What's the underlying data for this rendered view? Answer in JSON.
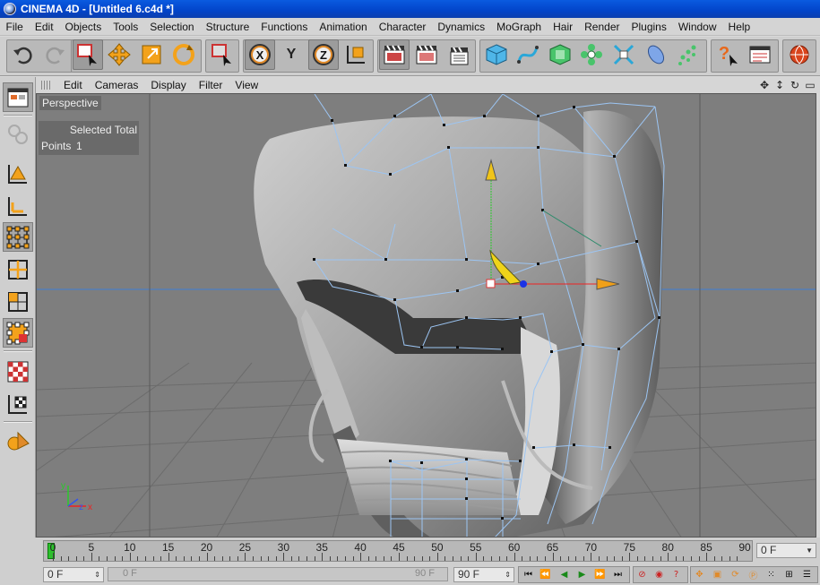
{
  "window": {
    "title": "CINEMA 4D - [Untitled 6.c4d *]"
  },
  "menubar": [
    "File",
    "Edit",
    "Objects",
    "Tools",
    "Selection",
    "Structure",
    "Functions",
    "Animation",
    "Character",
    "Dynamics",
    "MoGraph",
    "Hair",
    "Render",
    "Plugins",
    "Window",
    "Help"
  ],
  "toolbar": {
    "icons": [
      "undo-icon",
      "redo-icon",
      "rect-select-icon",
      "move-icon",
      "scale-icon",
      "rotate-icon",
      "select-mode-icon",
      "x-axis-icon",
      "y-axis-icon",
      "z-axis-icon",
      "world-coord-icon",
      "render-view-icon",
      "render-picture-icon",
      "render-settings-icon",
      "cube-icon",
      "spline-icon",
      "nurbs-icon",
      "array-icon",
      "deformer-icon",
      "scene-icon",
      "light-icon",
      "help-icon",
      "timeline-icon",
      "web-icon"
    ],
    "y_label": "Y"
  },
  "viewport_menu": [
    "Edit",
    "Cameras",
    "Display",
    "Filter",
    "View"
  ],
  "viewport": {
    "name": "Perspective",
    "hud_header": "Selected Total",
    "hud_row_label": "Points",
    "hud_row_value": "1"
  },
  "timeline": {
    "labels": [
      "0",
      "5",
      "10",
      "15",
      "20",
      "25",
      "30",
      "35",
      "40",
      "45",
      "50",
      "55",
      "60",
      "65",
      "70",
      "75",
      "80",
      "85",
      "90"
    ],
    "current_frame": "0 F",
    "start_field": "0 F",
    "slider_start": "0 F",
    "slider_end": "90 F",
    "end_field": "90 F"
  },
  "colors": {
    "accent_green": "#2ec02e",
    "title_blue": "#0244c9",
    "viewport_bg": "#7e7e7e"
  }
}
